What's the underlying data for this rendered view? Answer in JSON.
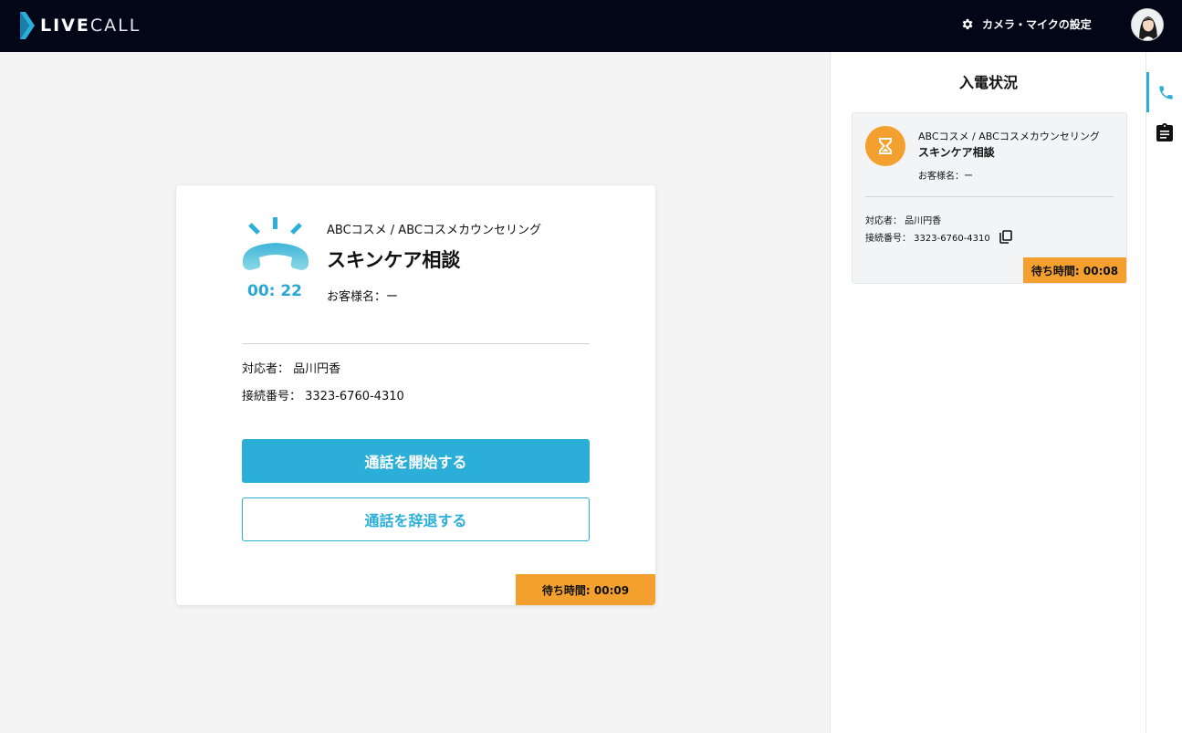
{
  "header": {
    "logo_bold": "LIVE",
    "logo_thin": "CALL",
    "settings_label": "カメラ・マイクの設定",
    "settings_icon": "gear-icon",
    "avatar_icon": "user-avatar"
  },
  "call_card": {
    "icon": "ringing-phone-icon",
    "timer": "00: 22",
    "service_path": "ABCコスメ / ABCコスメカウンセリング",
    "service_title": "スキンケア相談",
    "customer": "お客様名：ー",
    "agent": "対応者：  品川円香",
    "connection": "接続番号：  3323-6760-4310",
    "start_button": "通話を開始する",
    "decline_button": "通話を辞退する",
    "wait_time": "待ち時間: 00:09"
  },
  "panel": {
    "title": "入電状況",
    "item": {
      "icon": "hourglass-icon",
      "service_path": "ABCコスメ / ABCコスメカウンセリング",
      "service_title": "スキンケア相談",
      "customer": "お客様名：ー",
      "agent": "対応者：  品川円香",
      "connection": "接続番号：  3323-6760-4310",
      "copy_icon": "copy-icon",
      "wait_time": "待ち時間: 00:08"
    }
  },
  "rail": {
    "tabs": [
      {
        "icon": "phone-icon",
        "active": true
      },
      {
        "icon": "clipboard-icon",
        "active": false
      }
    ]
  },
  "colors": {
    "topbar": "#020617",
    "accent": "#2bafd9",
    "wait_badge": "#f3a02f",
    "background": "#f4f4f5"
  }
}
